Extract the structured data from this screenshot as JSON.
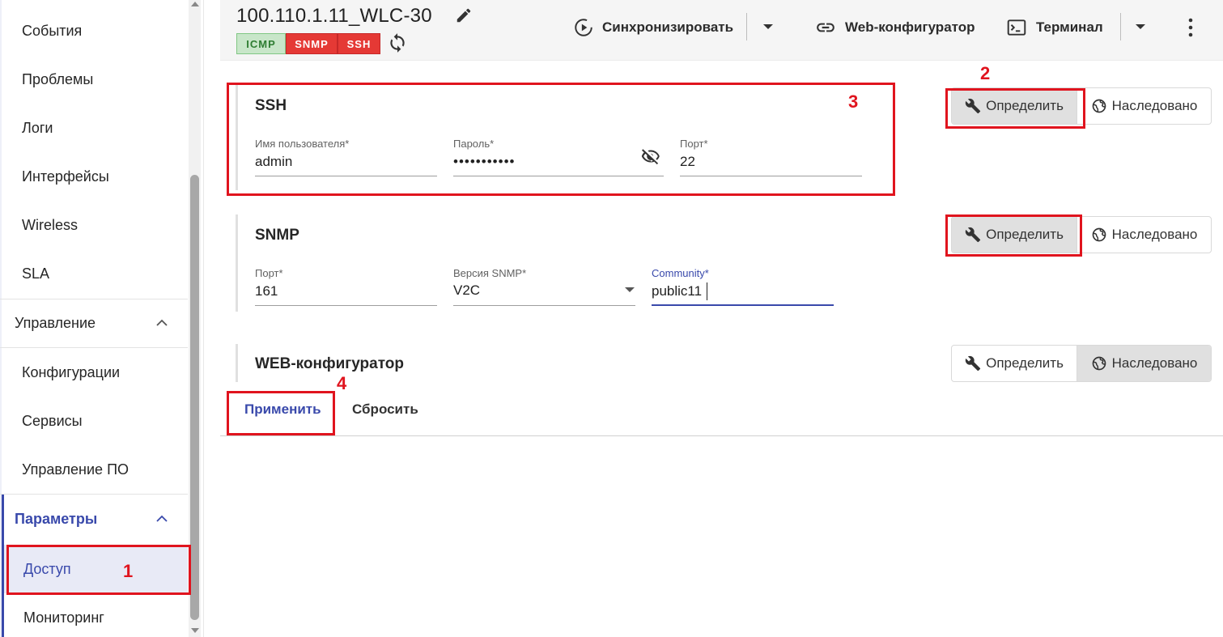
{
  "sidebar": {
    "items_top": [
      {
        "label": "События"
      },
      {
        "label": "Проблемы"
      },
      {
        "label": "Логи"
      },
      {
        "label": "Интерфейсы"
      },
      {
        "label": "Wireless"
      },
      {
        "label": "SLA"
      }
    ],
    "section_manage": {
      "label": "Управление",
      "icon": "chevron-up-icon"
    },
    "items_manage": [
      {
        "label": "Конфигурации"
      },
      {
        "label": "Сервисы"
      },
      {
        "label": "Управление ПО"
      }
    ],
    "section_params": {
      "label": "Параметры",
      "icon": "chevron-up-icon"
    },
    "items_params": [
      {
        "label": "Доступ",
        "active": true
      },
      {
        "label": "Мониторинг"
      }
    ]
  },
  "header": {
    "device_title": "100.110.1.11_WLC-30",
    "protocols": [
      {
        "label": "ICMP",
        "status_color": "#c8e6c9"
      },
      {
        "label": "SNMP",
        "status_color": "#e53935"
      },
      {
        "label": "SSH",
        "status_color": "#e53935"
      }
    ],
    "sync_label": "Синхронизировать",
    "webconfig_label": "Web-конфигуратор",
    "terminal_label": "Терминал"
  },
  "ssh": {
    "title": "SSH",
    "username": {
      "label": "Имя пользователя*",
      "value": "admin"
    },
    "password": {
      "label": "Пароль*",
      "value": "•••••••••••"
    },
    "port": {
      "label": "Порт*",
      "value": "22"
    },
    "mode_define": "Определить",
    "mode_inherited": "Наследовано",
    "selected": "define"
  },
  "snmp": {
    "title": "SNMP",
    "port": {
      "label": "Порт*",
      "value": "161"
    },
    "version": {
      "label": "Версия SNMP*",
      "value": "V2C"
    },
    "community": {
      "label": "Community*",
      "value": "public11"
    },
    "mode_define": "Определить",
    "mode_inherited": "Наследовано",
    "selected": "define"
  },
  "web": {
    "title": "WEB-конфигуратор",
    "mode_define": "Определить",
    "mode_inherited": "Наследовано",
    "selected": "inherited"
  },
  "actions": {
    "apply_label": "Применить",
    "reset_label": "Сбросить"
  },
  "annotations": [
    "1",
    "2",
    "3",
    "4"
  ],
  "colors": {
    "accent": "#3949ab",
    "annotation": "#e0141e"
  }
}
